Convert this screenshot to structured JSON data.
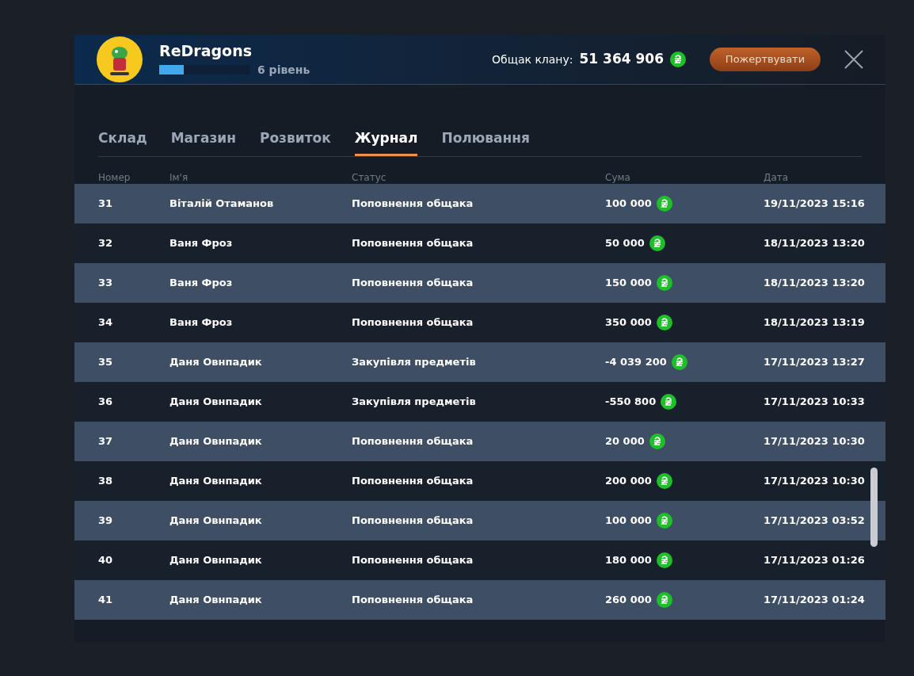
{
  "clan": {
    "name": "ReDragons",
    "level": 0.27,
    "rank": "6 рівень"
  },
  "treasury": {
    "label": "Общак клану:",
    "amount": "51 364 906"
  },
  "donate_button": "Пожертвувати",
  "tabs": [
    {
      "label": "Склад",
      "selected": false
    },
    {
      "label": "Магазин",
      "selected": false
    },
    {
      "label": "Розвиток",
      "selected": false
    },
    {
      "label": "Журнал",
      "selected": true
    },
    {
      "label": "Полювання",
      "selected": false
    }
  ],
  "table": {
    "columns": [
      "Номер",
      "Ім'я",
      "Статус",
      "Сума",
      "Дата"
    ],
    "rows": [
      {
        "number": "31",
        "name": "Віталій Отаманов",
        "status": "Поповнення общака",
        "amount": "100 000",
        "date": "19/11/2023 15:16"
      },
      {
        "number": "32",
        "name": "Ваня Фроз",
        "status": "Поповнення общака",
        "amount": "50 000",
        "date": "18/11/2023 13:20"
      },
      {
        "number": "33",
        "name": "Ваня Фроз",
        "status": "Поповнення общака",
        "amount": "150 000",
        "date": "18/11/2023 13:20"
      },
      {
        "number": "34",
        "name": "Ваня Фроз",
        "status": "Поповнення общака",
        "amount": "350 000",
        "date": "18/11/2023 13:19"
      },
      {
        "number": "35",
        "name": "Даня Овнпадик",
        "status": "Закупівля предметів",
        "amount": "-4 039 200",
        "date": "17/11/2023 13:27"
      },
      {
        "number": "36",
        "name": "Даня Овнпадик",
        "status": "Закупівля предметів",
        "amount": "-550 800",
        "date": "17/11/2023 10:33"
      },
      {
        "number": "37",
        "name": "Даня Овнпадик",
        "status": "Поповнення общака",
        "amount": "20 000",
        "date": "17/11/2023 10:30"
      },
      {
        "number": "38",
        "name": "Даня Овнпадик",
        "status": "Поповнення общака",
        "amount": "200 000",
        "date": "17/11/2023 10:30"
      },
      {
        "number": "39",
        "name": "Даня Овнпадик",
        "status": "Поповнення общака",
        "amount": "100 000",
        "date": "17/11/2023 03:52"
      },
      {
        "number": "40",
        "name": "Даня Овнпадик",
        "status": "Поповнення общака",
        "amount": "180 000",
        "date": "17/11/2023 01:26"
      },
      {
        "number": "41",
        "name": "Даня Овнпадик",
        "status": "Поповнення общака",
        "amount": "260 000",
        "date": "17/11/2023 01:24"
      }
    ]
  }
}
